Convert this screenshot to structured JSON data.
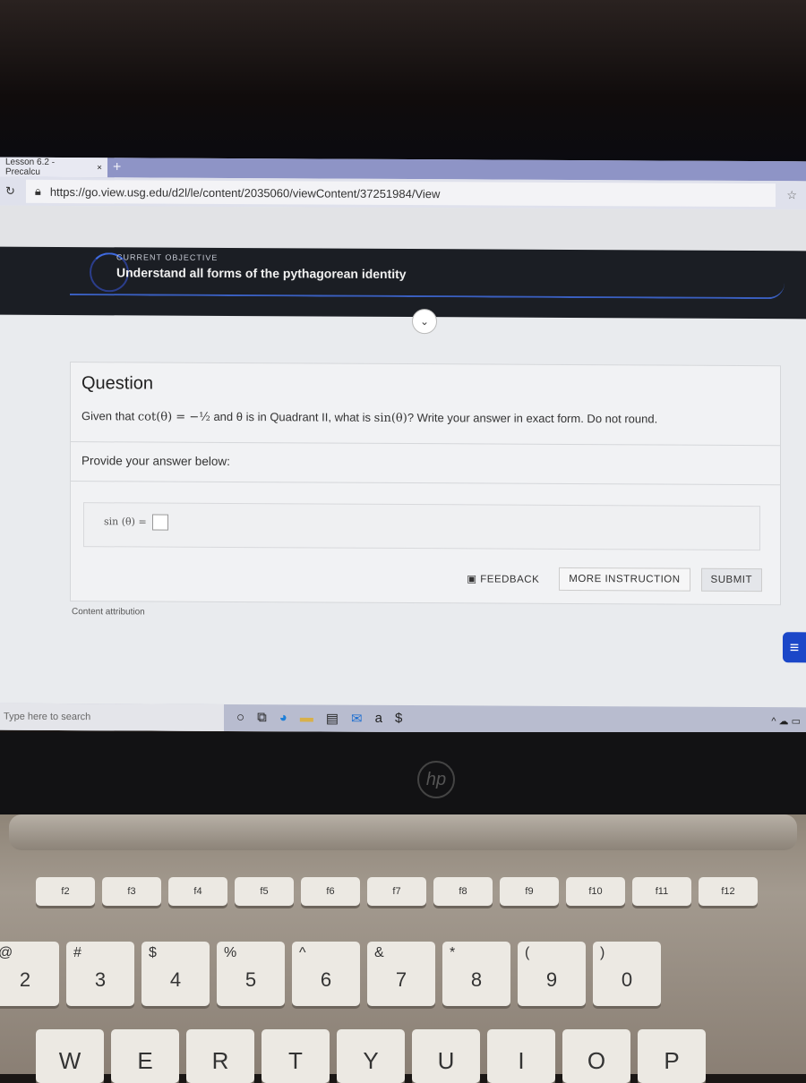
{
  "browser": {
    "tab_title": "Lesson 6.2 - Precalcu",
    "tab_close": "×",
    "new_tab": "+",
    "url": "https://go.view.usg.edu/d2l/le/content/2035060/viewContent/37251984/View"
  },
  "objective": {
    "label": "CURRENT OBJECTIVE",
    "title": "Understand all forms of the pythagorean identity"
  },
  "question": {
    "heading": "Question",
    "text_pre": "Given that ",
    "cot": "cot(θ) = −½",
    "text_mid": " and θ is in Quadrant II, what is ",
    "sin": "sin(θ)",
    "text_post": "? Write your answer in exact form. Do not round.",
    "provide": "Provide your answer below:",
    "answer_label": "sin (θ) =",
    "answer_value": ""
  },
  "buttons": {
    "feedback": "FEEDBACK",
    "more_instruction": "MORE INSTRUCTION",
    "submit": "SUBMIT"
  },
  "attribution": "Content attribution",
  "taskbar": {
    "search_placeholder": "Type here to search"
  },
  "laptop": {
    "logo": "hp",
    "fkeys": [
      "f2",
      "f3",
      "f4",
      "f5",
      "f6",
      "f7",
      "f8",
      "f9",
      "f10",
      "f11",
      "f12"
    ],
    "number_keys": [
      {
        "top": "@",
        "main": "2"
      },
      {
        "top": "#",
        "main": "3"
      },
      {
        "top": "$",
        "main": "4"
      },
      {
        "top": "%",
        "main": "5"
      },
      {
        "top": "^",
        "main": "6"
      },
      {
        "top": "&",
        "main": "7"
      },
      {
        "top": "*",
        "main": "8"
      },
      {
        "top": "(",
        "main": "9"
      },
      {
        "top": ")",
        "main": "0"
      }
    ],
    "letter_keys": [
      "W",
      "E",
      "R",
      "T",
      "Y",
      "U",
      "I",
      "O",
      "P"
    ]
  }
}
